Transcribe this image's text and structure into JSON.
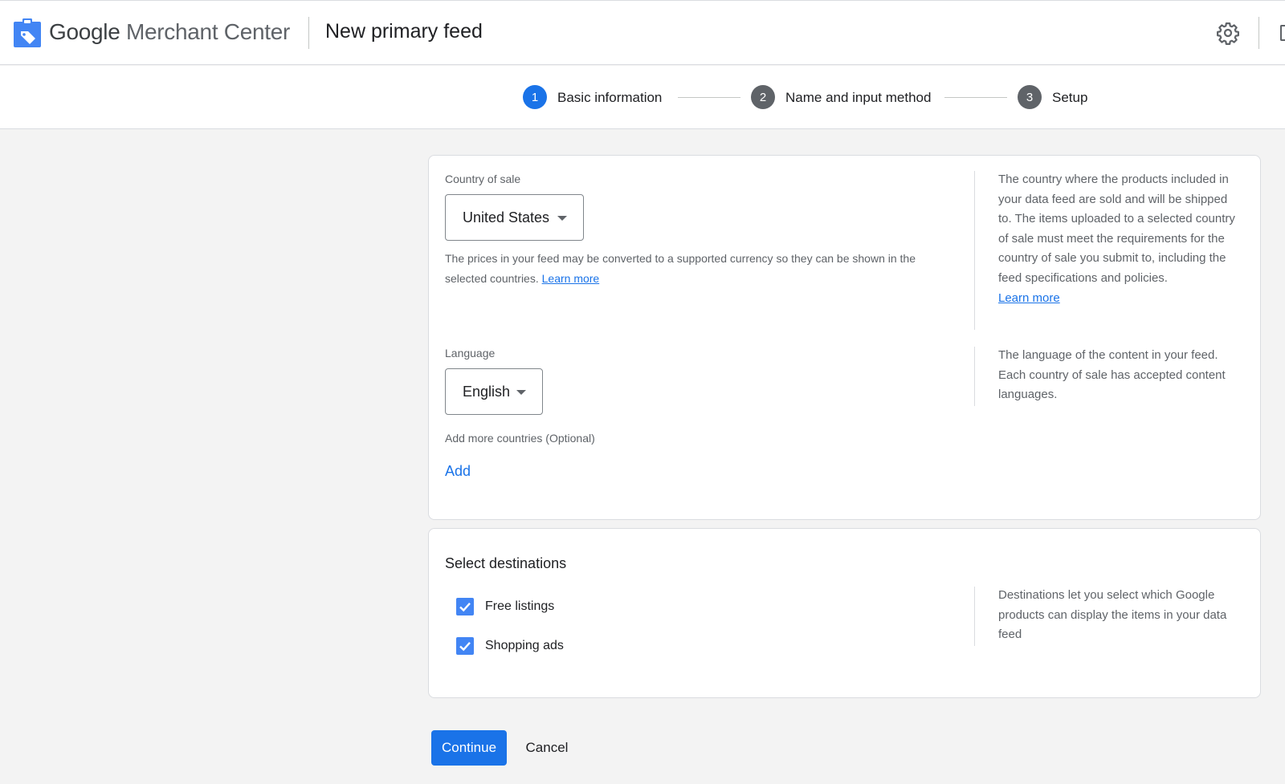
{
  "header": {
    "brand_google": "Google",
    "brand_product": "Merchant Center",
    "page_title": "New primary feed"
  },
  "stepper": {
    "steps": [
      {
        "number": "1",
        "label": "Basic information",
        "state": "active"
      },
      {
        "number": "2",
        "label": "Name and input method",
        "state": "inactive"
      },
      {
        "number": "3",
        "label": "Setup",
        "state": "inactive"
      }
    ]
  },
  "basic_info": {
    "country": {
      "label": "Country of sale",
      "value": "United States",
      "helper_text": "The prices in your feed may be converted to a supported currency so they can be shown in the selected countries.",
      "helper_link": "Learn more",
      "side_text": "The country where the products included in your data feed are sold and will be shipped to. The items uploaded to a selected country of sale must meet the requirements for the country of sale you submit to, including the feed specifications and policies.",
      "side_link": "Learn more"
    },
    "language": {
      "label": "Language",
      "value": "English",
      "side_text": "The language of the content in your feed. Each country of sale has accepted content languages."
    },
    "more_countries": {
      "label": "Add more countries (Optional)",
      "add_label": "Add"
    }
  },
  "destinations": {
    "title": "Select destinations",
    "options": [
      {
        "label": "Free listings",
        "checked": true
      },
      {
        "label": "Shopping ads",
        "checked": true
      }
    ],
    "side_text": "Destinations let you select which Google products can display the items in your data feed"
  },
  "actions": {
    "continue_label": "Continue",
    "cancel_label": "Cancel"
  },
  "colors": {
    "primary": "#1a73e8",
    "checkbox": "#4285f4",
    "step_inactive": "#5f6368"
  },
  "icons": {
    "logo": "merchant-center-tag-icon",
    "settings": "gear-icon",
    "dropdown": "caret-down-icon",
    "checkbox": "check-icon"
  }
}
